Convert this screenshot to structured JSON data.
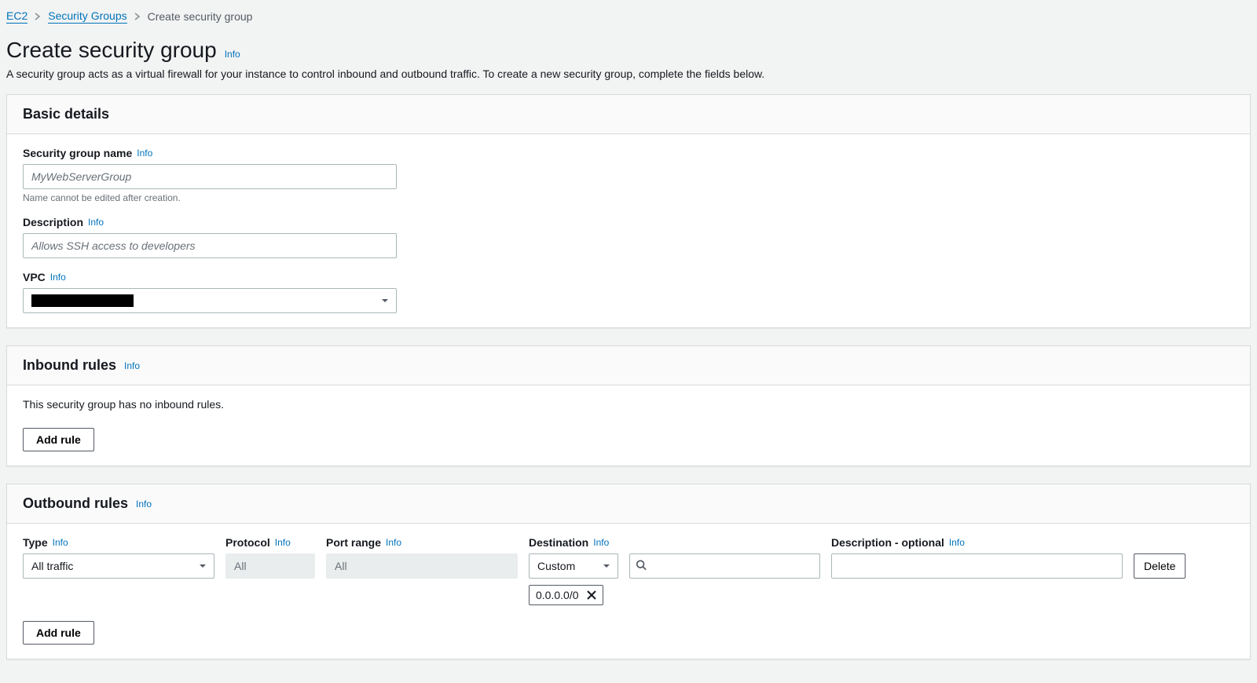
{
  "breadcrumbs": {
    "items": [
      {
        "label": "EC2",
        "link": true
      },
      {
        "label": "Security Groups",
        "link": true
      },
      {
        "label": "Create security group",
        "link": false
      }
    ]
  },
  "header": {
    "title": "Create security group",
    "info": "Info",
    "description": "A security group acts as a virtual firewall for your instance to control inbound and outbound traffic. To create a new security group, complete the fields below."
  },
  "basic_details": {
    "title": "Basic details",
    "name_label": "Security group name",
    "name_info": "Info",
    "name_placeholder": "MyWebServerGroup",
    "name_hint": "Name cannot be edited after creation.",
    "desc_label": "Description",
    "desc_info": "Info",
    "desc_placeholder": "Allows SSH access to developers",
    "vpc_label": "VPC",
    "vpc_info": "Info",
    "vpc_value_redacted": true
  },
  "inbound": {
    "title": "Inbound rules",
    "info": "Info",
    "empty_message": "This security group has no inbound rules.",
    "add_rule_label": "Add rule"
  },
  "outbound": {
    "title": "Outbound rules",
    "info": "Info",
    "columns": {
      "type_label": "Type",
      "type_info": "Info",
      "protocol_label": "Protocol",
      "protocol_info": "Info",
      "port_label": "Port range",
      "port_info": "Info",
      "dest_label": "Destination",
      "dest_info": "Info",
      "desc_label": "Description - optional",
      "desc_info": "Info"
    },
    "rule": {
      "type_value": "All traffic",
      "protocol_value": "All",
      "port_value": "All",
      "dest_mode": "Custom",
      "dest_search": "",
      "dest_tags": [
        "0.0.0.0/0"
      ],
      "description_value": ""
    },
    "delete_label": "Delete",
    "add_rule_label": "Add rule"
  }
}
